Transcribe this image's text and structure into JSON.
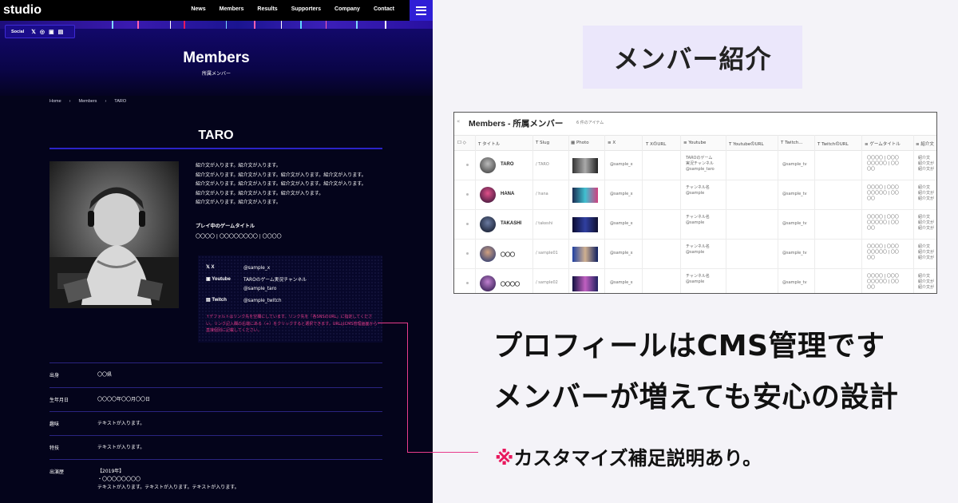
{
  "site": {
    "logo": "studio",
    "nav": [
      "News",
      "Members",
      "Results",
      "Supporters",
      "Company",
      "Contact"
    ],
    "social_label": "Social",
    "social_icons": [
      "x-icon",
      "instagram-icon",
      "youtube-icon",
      "twitch-icon"
    ],
    "hero_title": "Members",
    "hero_subtitle": "所属メンバー",
    "breadcrumb": [
      "Home",
      "Members",
      "TARO"
    ],
    "member_name": "TARO",
    "bio_lines": [
      "紹介文が入ります。紹介文が入ります。",
      "紹介文が入ります。紹介文が入ります。紹介文が入ります。紹介文が入ります。",
      "紹介文が入ります。紹介文が入ります。紹介文が入ります。紹介文が入ります。",
      "紹介文が入ります。紹介文が入ります。紹介文が入ります。",
      "紹介文が入ります。紹介文が入ります。"
    ],
    "game_heading": "プレイ中のゲームタイトル",
    "game_value": "〇〇〇〇 | 〇〇〇〇〇〇〇〇 | 〇〇〇〇",
    "sns": [
      {
        "label": "X",
        "value": "@sample_x"
      },
      {
        "label": "Youtube",
        "value": "TAROのゲーム実況チャンネル\n@sample_taro"
      },
      {
        "label": "Twitch",
        "value": "@sample_twitch"
      }
    ],
    "sns_note": "↑デフォルトはリンク先を空欄にしています。リンク先を「各SNSのURL」に指定してください。リンク記入欄の右端にある（+）をクリックすると選択できます。URLはCMS管理画面から直接個別に記載してください。",
    "profile": [
      {
        "label": "出身",
        "value": "〇〇県"
      },
      {
        "label": "生年月日",
        "value": "〇〇〇〇年〇〇月〇〇日"
      },
      {
        "label": "趣味",
        "value": "テキストが入ります。"
      },
      {
        "label": "特技",
        "value": "テキストが入ります。"
      },
      {
        "label": "出演歴",
        "value": "【2019年】\n・〇〇〇〇〇〇〇〇\nテキストが入ります。テキストが入ります。テキストが入ります。"
      }
    ]
  },
  "promo": {
    "badge": "メンバー紹介",
    "headline_1": "プロフィールはCMS管理です",
    "headline_2": "メンバーが増えても安心の設計",
    "note_mark": "※",
    "note_text": "カスタマイズ補足説明あり。"
  },
  "cms": {
    "title": "Members - 所属メンバー",
    "item_count": "6 件のアイテム",
    "columns": [
      "タイトル",
      "Slug",
      "Photo",
      "X",
      "XのURL",
      "Youtube",
      "YoutubeのURL",
      "Twitch...",
      "TwitchのURL",
      "ゲームタイトル",
      "紹介文"
    ],
    "rows": [
      {
        "name": "TARO",
        "slug": "/ TARO",
        "x": "@sample_x",
        "youtube": "TAROのゲーム\n実況チャンネル\n@sample_taro",
        "twitch": "@sample_tv",
        "games": "〇〇〇〇 | 〇〇〇\n〇〇〇〇〇 | 〇〇\n〇〇",
        "intro": "紹介文\n紹介文が\n紹介文が"
      },
      {
        "name": "HANA",
        "slug": "/ hana",
        "x": "@sample_x",
        "youtube": "チャンネル名\n@sample",
        "twitch": "@sample_tv",
        "games": "〇〇〇〇 | 〇〇〇\n〇〇〇〇〇 | 〇〇\n〇〇",
        "intro": "紹介文\n紹介文が\n紹介文が"
      },
      {
        "name": "TAKASHI",
        "slug": "/ takeshi",
        "x": "@sample_x",
        "youtube": "チャンネル名\n@sample",
        "twitch": "@sample_tv",
        "games": "〇〇〇〇 | 〇〇〇\n〇〇〇〇〇 | 〇〇\n〇〇",
        "intro": "紹介文\n紹介文が\n紹介文が"
      },
      {
        "name": "〇〇〇",
        "slug": "/ sample01",
        "x": "@sample_x",
        "youtube": "チャンネル名\n@sample",
        "twitch": "@sample_tv",
        "games": "〇〇〇〇 | 〇〇〇\n〇〇〇〇〇 | 〇〇\n〇〇",
        "intro": "紹介文\n紹介文が\n紹介文が"
      },
      {
        "name": "〇〇〇〇",
        "slug": "/ sample02",
        "x": "@sample_x",
        "youtube": "チャンネル名\n@sample",
        "twitch": "@sample_tv",
        "games": "〇〇〇〇 | 〇〇〇\n〇〇〇〇〇 | 〇〇\n〇〇",
        "intro": "紹介文\n紹介文が\n紹介文が"
      }
    ]
  },
  "colors": {
    "accent": "#2f1fd6",
    "site_bg": "#04041b",
    "note_pink": "#e83c8c",
    "mark_red": "#e8175d",
    "badge_bg": "#ebe7fb"
  }
}
